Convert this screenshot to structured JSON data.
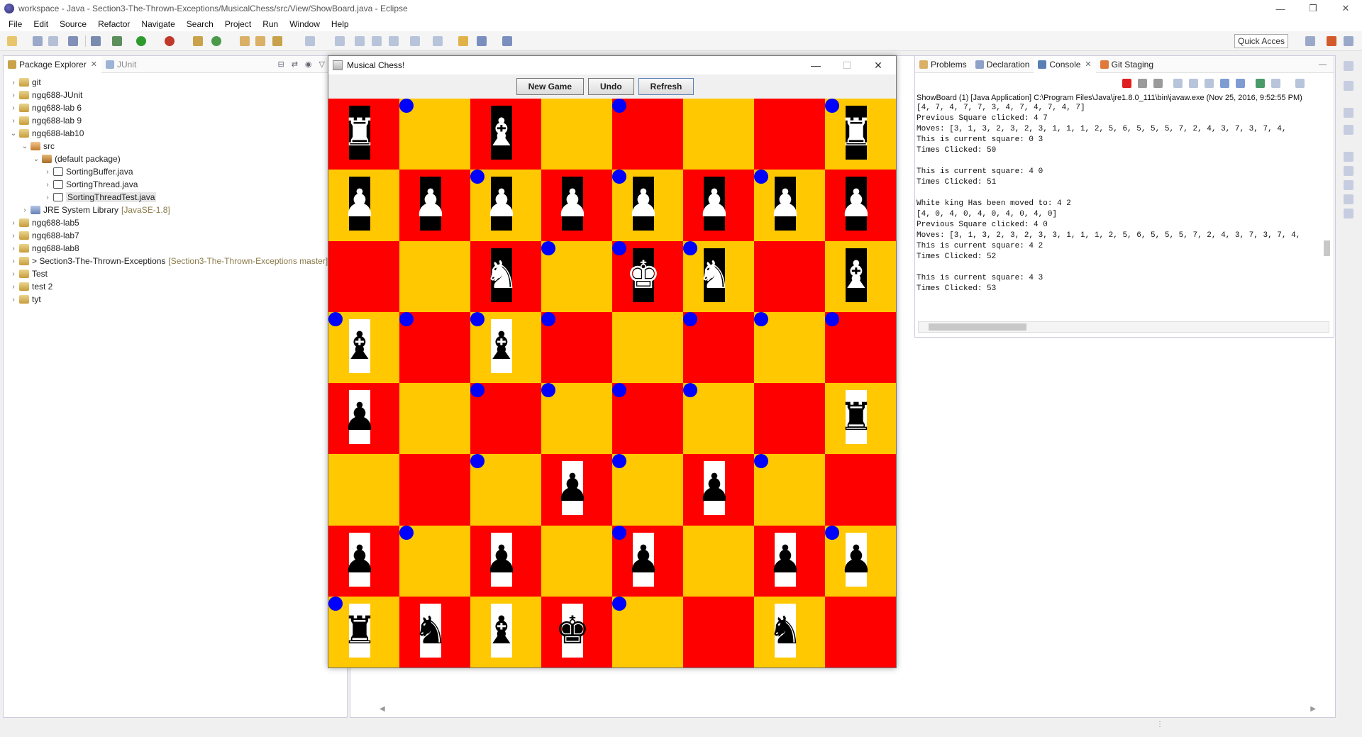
{
  "window": {
    "title": "workspace - Java - Section3-The-Thrown-Exceptions/MusicalChess/src/View/ShowBoard.java - Eclipse"
  },
  "menubar": [
    "File",
    "Edit",
    "Source",
    "Refactor",
    "Navigate",
    "Search",
    "Project",
    "Run",
    "Window",
    "Help"
  ],
  "toolbar": {
    "quick_access": "Quick Access"
  },
  "package_explorer": {
    "tabs": [
      {
        "label": "Package Explorer",
        "active": true
      },
      {
        "label": "JUnit",
        "active": false
      }
    ],
    "tree": [
      {
        "label": "git",
        "deco": "",
        "chev": "›",
        "icon": "project-icon",
        "level": 0
      },
      {
        "label": "ngq688-JUnit",
        "deco": "",
        "chev": "›",
        "icon": "project-icon",
        "level": 0
      },
      {
        "label": "ngq688-lab 6",
        "deco": "",
        "chev": "›",
        "icon": "project-icon",
        "level": 0
      },
      {
        "label": "ngq688-lab 9",
        "deco": "",
        "chev": "›",
        "icon": "project-icon",
        "level": 0
      },
      {
        "label": "ngq688-lab10",
        "deco": "",
        "chev": "⌄",
        "icon": "project-icon",
        "level": 0
      },
      {
        "label": "src",
        "deco": "",
        "chev": "⌄",
        "icon": "source-folder-icon",
        "level": 1
      },
      {
        "label": "(default package)",
        "deco": "",
        "chev": "⌄",
        "icon": "package-icon",
        "level": 2
      },
      {
        "label": "SortingBuffer.java",
        "deco": "",
        "chev": "›",
        "icon": "java-file-icon",
        "level": 3
      },
      {
        "label": "SortingThread.java",
        "deco": "",
        "chev": "›",
        "icon": "java-file-icon",
        "level": 3
      },
      {
        "label": "SortingThreadTest.java",
        "deco": "",
        "chev": "›",
        "icon": "java-file-icon",
        "level": 3,
        "selected": true
      },
      {
        "label": "JRE System Library",
        "deco": "[JavaSE-1.8]",
        "chev": "›",
        "icon": "library-icon",
        "level": 1
      },
      {
        "label": "ngq688-lab5",
        "deco": "",
        "chev": "›",
        "icon": "project-icon",
        "level": 0
      },
      {
        "label": "ngq688-lab7",
        "deco": "",
        "chev": "›",
        "icon": "project-icon",
        "level": 0
      },
      {
        "label": "ngq688-lab8",
        "deco": "",
        "chev": "›",
        "icon": "project-icon",
        "level": 0
      },
      {
        "label": "> Section3-The-Thrown-Exceptions",
        "deco": "[Section3-The-Thrown-Exceptions master]",
        "chev": "›",
        "icon": "project-icon",
        "level": 0
      },
      {
        "label": "Test",
        "deco": "",
        "chev": "›",
        "icon": "project-icon",
        "level": 0
      },
      {
        "label": "test 2",
        "deco": "",
        "chev": "›",
        "icon": "project-icon",
        "level": 0
      },
      {
        "label": "tyt",
        "deco": "",
        "chev": "›",
        "icon": "project-icon",
        "level": 0
      }
    ]
  },
  "console_panel": {
    "tabs": [
      {
        "label": "Problems",
        "active": false
      },
      {
        "label": "Declaration",
        "active": false
      },
      {
        "label": "Console",
        "active": true
      },
      {
        "label": "Git Staging",
        "active": false
      }
    ],
    "header": "ShowBoard (1) [Java Application] C:\\Program Files\\Java\\jre1.8.0_111\\bin\\javaw.exe (Nov 25, 2016, 9:52:55 PM)",
    "output": "[4, 7, 4, 7, 7, 3, 4, 7, 4, 7, 4, 7]\nPrevious Square clicked: 4 7\nMoves: [3, 1, 3, 2, 3, 2, 3, 1, 1, 1, 2, 5, 6, 5, 5, 5, 7, 2, 4, 3, 7, 3, 7, 4,\nThis is current square: 0 3\nTimes Clicked: 50\n\nThis is current square: 4 0\nTimes Clicked: 51\n\nWhite king Has been moved to: 4 2\n[4, 0, 4, 0, 4, 0, 4, 0, 4, 0]\nPrevious Square clicked: 4 0\nMoves: [3, 1, 3, 2, 3, 2, 3, 3, 1, 1, 1, 2, 5, 6, 5, 5, 5, 7, 2, 4, 3, 7, 3, 7, 4,\nThis is current square: 4 2\nTimes Clicked: 52\n\nThis is current square: 4 3\nTimes Clicked: 53"
  },
  "chess_window": {
    "title": "Musical Chess!",
    "buttons": [
      "New Game",
      "Undo",
      "Refresh"
    ],
    "colors": {
      "red": "#ff0000",
      "yellow": "#ffc800",
      "dot": "#0000ff"
    },
    "board": [
      [
        {
          "c": "red",
          "p": "wR"
        },
        {
          "c": "yellow",
          "p": "",
          "d": true
        },
        {
          "c": "red",
          "p": "wB"
        },
        {
          "c": "yellow",
          "p": ""
        },
        {
          "c": "red",
          "p": "",
          "d": true
        },
        {
          "c": "yellow",
          "p": ""
        },
        {
          "c": "red",
          "p": ""
        },
        {
          "c": "yellow",
          "p": "wR",
          "d": true
        }
      ],
      [
        {
          "c": "yellow",
          "p": "wP"
        },
        {
          "c": "red",
          "p": "wP"
        },
        {
          "c": "yellow",
          "p": "wP",
          "d": true
        },
        {
          "c": "red",
          "p": "wP"
        },
        {
          "c": "yellow",
          "p": "wP",
          "d": true
        },
        {
          "c": "red",
          "p": "wP"
        },
        {
          "c": "yellow",
          "p": "wP",
          "d": true
        },
        {
          "c": "red",
          "p": "wP"
        }
      ],
      [
        {
          "c": "red",
          "p": ""
        },
        {
          "c": "yellow",
          "p": ""
        },
        {
          "c": "red",
          "p": "wN"
        },
        {
          "c": "yellow",
          "p": "",
          "d": true
        },
        {
          "c": "red",
          "p": "wK",
          "d": true
        },
        {
          "c": "yellow",
          "p": "wN",
          "d": true
        },
        {
          "c": "red",
          "p": ""
        },
        {
          "c": "yellow",
          "p": "wB"
        }
      ],
      [
        {
          "c": "yellow",
          "p": "bB",
          "d": true
        },
        {
          "c": "red",
          "p": "",
          "d": true
        },
        {
          "c": "yellow",
          "p": "bB",
          "d": true
        },
        {
          "c": "red",
          "p": "",
          "d": true
        },
        {
          "c": "yellow",
          "p": ""
        },
        {
          "c": "red",
          "p": "",
          "d": true
        },
        {
          "c": "yellow",
          "p": "",
          "d": true
        },
        {
          "c": "red",
          "p": "",
          "d": true
        }
      ],
      [
        {
          "c": "red",
          "p": "bP"
        },
        {
          "c": "yellow",
          "p": ""
        },
        {
          "c": "red",
          "p": "",
          "d": true
        },
        {
          "c": "yellow",
          "p": "",
          "d": true
        },
        {
          "c": "red",
          "p": "",
          "d": true
        },
        {
          "c": "yellow",
          "p": "",
          "d": true
        },
        {
          "c": "red",
          "p": ""
        },
        {
          "c": "yellow",
          "p": "bR"
        }
      ],
      [
        {
          "c": "yellow",
          "p": ""
        },
        {
          "c": "red",
          "p": ""
        },
        {
          "c": "yellow",
          "p": "",
          "d": true
        },
        {
          "c": "red",
          "p": "bP"
        },
        {
          "c": "yellow",
          "p": "",
          "d": true
        },
        {
          "c": "red",
          "p": "bP"
        },
        {
          "c": "yellow",
          "p": "",
          "d": true
        },
        {
          "c": "red",
          "p": ""
        }
      ],
      [
        {
          "c": "red",
          "p": "bP"
        },
        {
          "c": "yellow",
          "p": "",
          "d": true
        },
        {
          "c": "red",
          "p": "bP"
        },
        {
          "c": "yellow",
          "p": ""
        },
        {
          "c": "red",
          "p": "bP",
          "d": true
        },
        {
          "c": "yellow",
          "p": ""
        },
        {
          "c": "red",
          "p": "bP"
        },
        {
          "c": "yellow",
          "p": "bP",
          "d": true
        }
      ],
      [
        {
          "c": "yellow",
          "p": "bR",
          "d": true
        },
        {
          "c": "red",
          "p": "bN"
        },
        {
          "c": "yellow",
          "p": "bB"
        },
        {
          "c": "red",
          "p": "bK"
        },
        {
          "c": "yellow",
          "p": "",
          "d": true
        },
        {
          "c": "red",
          "p": ""
        },
        {
          "c": "yellow",
          "p": "bN"
        },
        {
          "c": "red",
          "p": ""
        }
      ]
    ]
  }
}
